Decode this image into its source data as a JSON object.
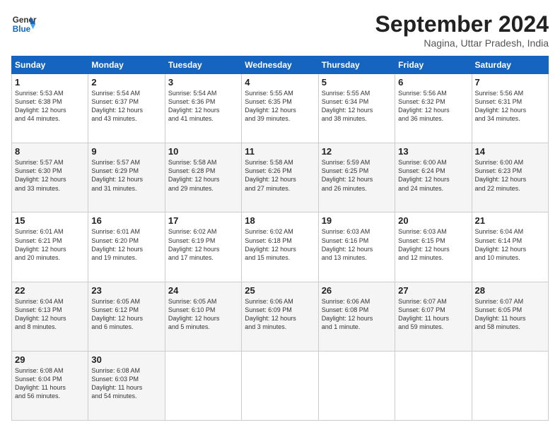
{
  "header": {
    "logo_line1": "General",
    "logo_line2": "Blue",
    "month": "September 2024",
    "location": "Nagina, Uttar Pradesh, India"
  },
  "days_of_week": [
    "Sunday",
    "Monday",
    "Tuesday",
    "Wednesday",
    "Thursday",
    "Friday",
    "Saturday"
  ],
  "weeks": [
    [
      {
        "day": "1",
        "info": "Sunrise: 5:53 AM\nSunset: 6:38 PM\nDaylight: 12 hours\nand 44 minutes."
      },
      {
        "day": "2",
        "info": "Sunrise: 5:54 AM\nSunset: 6:37 PM\nDaylight: 12 hours\nand 43 minutes."
      },
      {
        "day": "3",
        "info": "Sunrise: 5:54 AM\nSunset: 6:36 PM\nDaylight: 12 hours\nand 41 minutes."
      },
      {
        "day": "4",
        "info": "Sunrise: 5:55 AM\nSunset: 6:35 PM\nDaylight: 12 hours\nand 39 minutes."
      },
      {
        "day": "5",
        "info": "Sunrise: 5:55 AM\nSunset: 6:34 PM\nDaylight: 12 hours\nand 38 minutes."
      },
      {
        "day": "6",
        "info": "Sunrise: 5:56 AM\nSunset: 6:32 PM\nDaylight: 12 hours\nand 36 minutes."
      },
      {
        "day": "7",
        "info": "Sunrise: 5:56 AM\nSunset: 6:31 PM\nDaylight: 12 hours\nand 34 minutes."
      }
    ],
    [
      {
        "day": "8",
        "info": "Sunrise: 5:57 AM\nSunset: 6:30 PM\nDaylight: 12 hours\nand 33 minutes."
      },
      {
        "day": "9",
        "info": "Sunrise: 5:57 AM\nSunset: 6:29 PM\nDaylight: 12 hours\nand 31 minutes."
      },
      {
        "day": "10",
        "info": "Sunrise: 5:58 AM\nSunset: 6:28 PM\nDaylight: 12 hours\nand 29 minutes."
      },
      {
        "day": "11",
        "info": "Sunrise: 5:58 AM\nSunset: 6:26 PM\nDaylight: 12 hours\nand 27 minutes."
      },
      {
        "day": "12",
        "info": "Sunrise: 5:59 AM\nSunset: 6:25 PM\nDaylight: 12 hours\nand 26 minutes."
      },
      {
        "day": "13",
        "info": "Sunrise: 6:00 AM\nSunset: 6:24 PM\nDaylight: 12 hours\nand 24 minutes."
      },
      {
        "day": "14",
        "info": "Sunrise: 6:00 AM\nSunset: 6:23 PM\nDaylight: 12 hours\nand 22 minutes."
      }
    ],
    [
      {
        "day": "15",
        "info": "Sunrise: 6:01 AM\nSunset: 6:21 PM\nDaylight: 12 hours\nand 20 minutes."
      },
      {
        "day": "16",
        "info": "Sunrise: 6:01 AM\nSunset: 6:20 PM\nDaylight: 12 hours\nand 19 minutes."
      },
      {
        "day": "17",
        "info": "Sunrise: 6:02 AM\nSunset: 6:19 PM\nDaylight: 12 hours\nand 17 minutes."
      },
      {
        "day": "18",
        "info": "Sunrise: 6:02 AM\nSunset: 6:18 PM\nDaylight: 12 hours\nand 15 minutes."
      },
      {
        "day": "19",
        "info": "Sunrise: 6:03 AM\nSunset: 6:16 PM\nDaylight: 12 hours\nand 13 minutes."
      },
      {
        "day": "20",
        "info": "Sunrise: 6:03 AM\nSunset: 6:15 PM\nDaylight: 12 hours\nand 12 minutes."
      },
      {
        "day": "21",
        "info": "Sunrise: 6:04 AM\nSunset: 6:14 PM\nDaylight: 12 hours\nand 10 minutes."
      }
    ],
    [
      {
        "day": "22",
        "info": "Sunrise: 6:04 AM\nSunset: 6:13 PM\nDaylight: 12 hours\nand 8 minutes."
      },
      {
        "day": "23",
        "info": "Sunrise: 6:05 AM\nSunset: 6:12 PM\nDaylight: 12 hours\nand 6 minutes."
      },
      {
        "day": "24",
        "info": "Sunrise: 6:05 AM\nSunset: 6:10 PM\nDaylight: 12 hours\nand 5 minutes."
      },
      {
        "day": "25",
        "info": "Sunrise: 6:06 AM\nSunset: 6:09 PM\nDaylight: 12 hours\nand 3 minutes."
      },
      {
        "day": "26",
        "info": "Sunrise: 6:06 AM\nSunset: 6:08 PM\nDaylight: 12 hours\nand 1 minute."
      },
      {
        "day": "27",
        "info": "Sunrise: 6:07 AM\nSunset: 6:07 PM\nDaylight: 11 hours\nand 59 minutes."
      },
      {
        "day": "28",
        "info": "Sunrise: 6:07 AM\nSunset: 6:05 PM\nDaylight: 11 hours\nand 58 minutes."
      }
    ],
    [
      {
        "day": "29",
        "info": "Sunrise: 6:08 AM\nSunset: 6:04 PM\nDaylight: 11 hours\nand 56 minutes."
      },
      {
        "day": "30",
        "info": "Sunrise: 6:08 AM\nSunset: 6:03 PM\nDaylight: 11 hours\nand 54 minutes."
      },
      null,
      null,
      null,
      null,
      null
    ]
  ]
}
